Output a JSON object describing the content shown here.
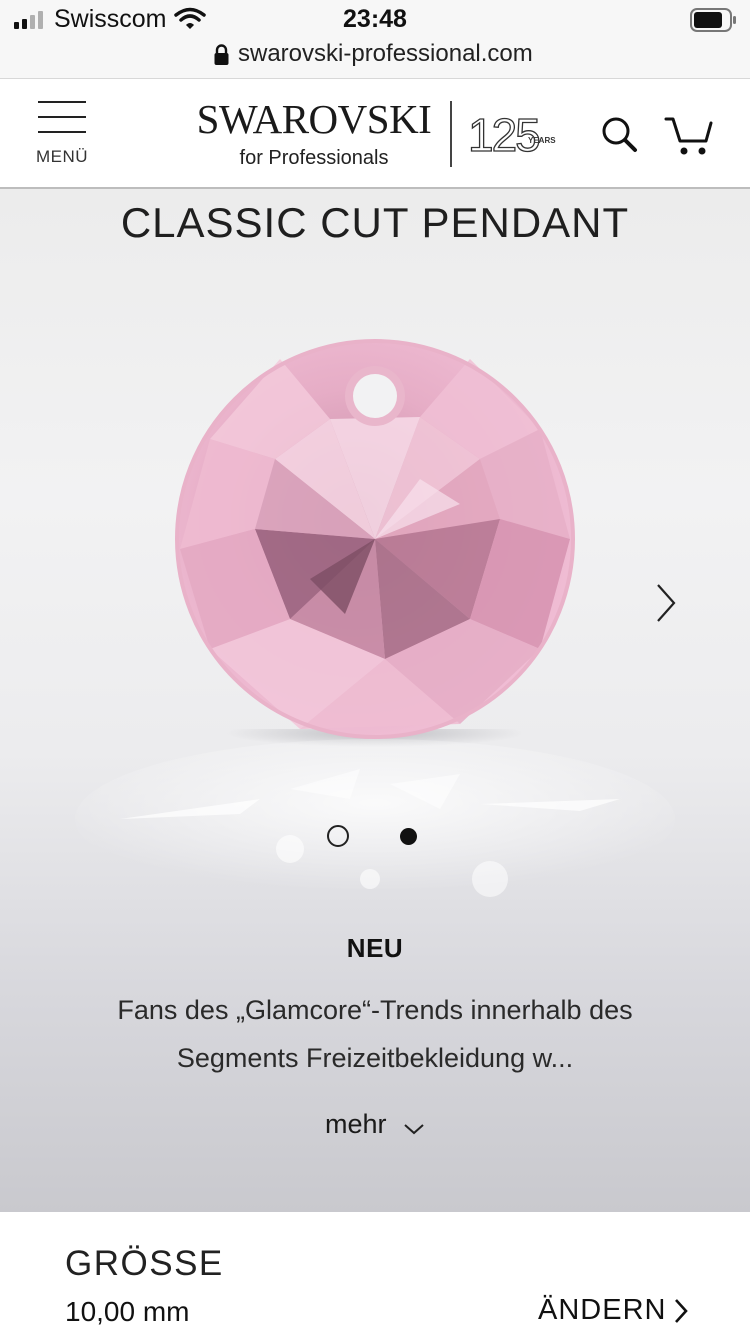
{
  "status_bar": {
    "carrier": "Swisscom",
    "time": "23:48"
  },
  "browser": {
    "url": "swarovski-professional.com"
  },
  "header": {
    "menu_label": "MENÜ",
    "brand_name": "SWAROVSKI",
    "brand_sub": "for Professionals",
    "anniversary_number": "125",
    "anniversary_word": "YEARS"
  },
  "product": {
    "title": "CLASSIC CUT PENDANT",
    "gem_color": "#e8a9c4",
    "carousel": {
      "slides": 2,
      "active_slide": 2
    },
    "badge": "NEU",
    "description_line1": "Fans des „Glamcore“-Trends innerhalb des",
    "description_line2": "Segments Freizeitbekleidung w...",
    "more_label": "mehr"
  },
  "size": {
    "label": "GRÖSSE",
    "value": "10,00 mm",
    "change_label": "ÄNDERN"
  },
  "icons": {
    "menu": "hamburger-icon",
    "search": "search-icon",
    "cart": "cart-icon",
    "next": "chevron-right-icon",
    "more": "chevron-down-icon",
    "lock": "lock-icon"
  }
}
